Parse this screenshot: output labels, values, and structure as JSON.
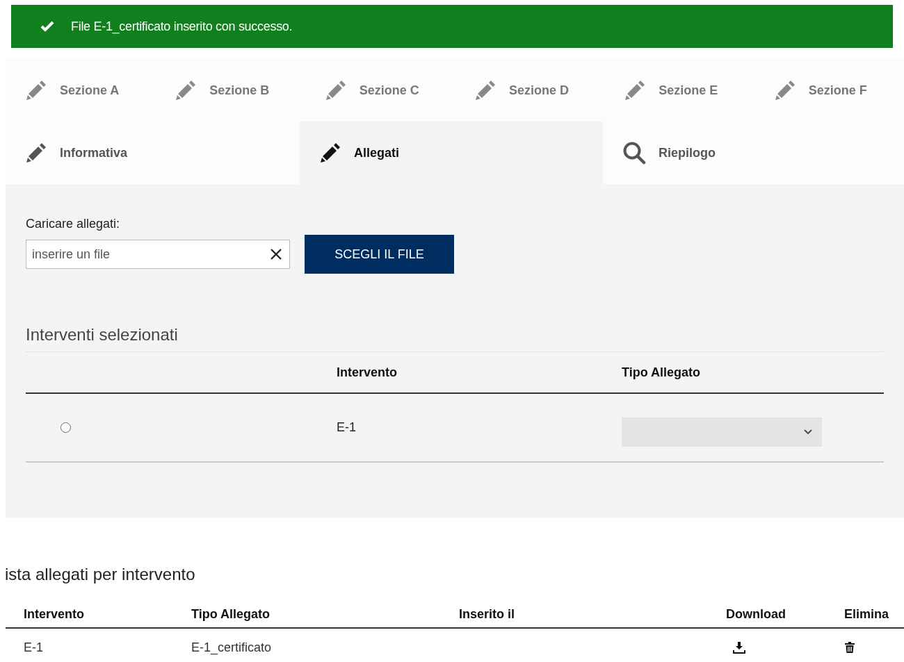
{
  "alert": {
    "message": "File E-1_certificato inserito con successo."
  },
  "tabs": [
    {
      "label": "Sezione A",
      "kind": "edit",
      "selected": false
    },
    {
      "label": "Sezione B",
      "kind": "edit",
      "selected": false
    },
    {
      "label": "Sezione C",
      "kind": "edit",
      "selected": false
    },
    {
      "label": "Sezione D",
      "kind": "edit",
      "selected": false
    },
    {
      "label": "Sezione E",
      "kind": "edit",
      "selected": false
    },
    {
      "label": "Sezione F",
      "kind": "edit",
      "selected": false
    },
    {
      "label": "Informativa",
      "kind": "edit",
      "selected": false
    },
    {
      "label": "Allegati",
      "kind": "edit",
      "selected": true
    },
    {
      "label": "Riepilogo",
      "kind": "search",
      "selected": false
    }
  ],
  "upload": {
    "label": "Caricare allegati:",
    "placeholder": "inserire un file",
    "button": "SCEGLI IL FILE"
  },
  "interventi": {
    "title": "Interventi selezionati",
    "columns": [
      "Intervento",
      "Tipo Allegato"
    ],
    "rows": [
      {
        "selected": false,
        "intervento": "E-1"
      }
    ]
  },
  "lista": {
    "title": "ista allegati per intervento",
    "columns": [
      "Intervento",
      "Tipo Allegato",
      "Inserito il",
      "Download",
      "Elimina"
    ],
    "rows": [
      {
        "intervento": "E-1",
        "tipo": "E-1_certificato"
      }
    ]
  }
}
